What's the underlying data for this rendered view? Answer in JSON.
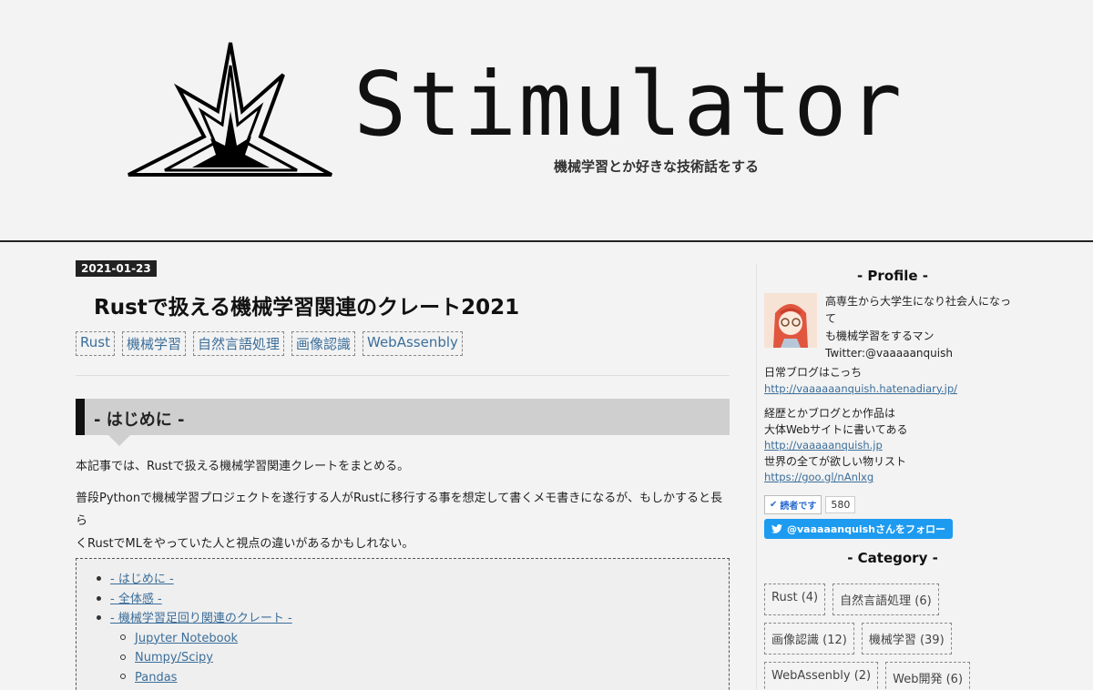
{
  "header": {
    "title": "Stimulator",
    "description": "機械学習とか好きな技術話をする",
    "logo_icon": "starburst-logo-icon"
  },
  "entry": {
    "date": "2021-01-23",
    "title": "Rustで扱える機械学習関連のクレート2021",
    "tags": [
      "Rust",
      "機械学習",
      "自然言語処理",
      "画像認識",
      "WebAssenbly"
    ],
    "section_heading": "- はじめに -",
    "paragraph1": "本記事では、Rustで扱える機械学習関連クレートをまとめる。",
    "paragraph2_line1": "普段Pythonで機械学習プロジェクトを遂行する人がRustに移行する事を想定して書くメモ書きになるが、もしかすると長ら",
    "paragraph2_line2": "くRustでMLをやっていた人と視点の違いがあるかもしれない。",
    "toc": {
      "items": [
        "- はじめに -",
        "- 全体感 -",
        "- 機械学習足回り関連のクレート -"
      ],
      "subitems": [
        "Jupyter Notebook",
        "Numpy/Scipy",
        "Pandas"
      ]
    }
  },
  "sidebar": {
    "profile_heading": "- Profile -",
    "profile_line1": "高専生から大学生になり社会人になって",
    "profile_line2": "も機械学習をするマン",
    "profile_line3": "Twitter:@vaaaaanquish",
    "daily_blog_label": "日常ブログはこっち",
    "daily_blog_link": "http://vaaaaaanquish.hatenadiary.jp/",
    "career_line1": "経歴とかブログとか作品は",
    "career_line2": "大体Webサイトに書いてある",
    "career_link": "http://vaaaaanquish.jp",
    "wishlist_label": "世界の全てが欲しい物リスト",
    "wishlist_link": "https://goo.gl/nAnlxg",
    "reader_label": "読者です",
    "reader_count": "580",
    "follow_label": "@vaaaaanquishさんをフォロー",
    "category_heading": "- Category -",
    "categories": [
      "Rust (4)",
      "自然言語処理 (6)",
      "画像認識 (12)",
      "機械学習 (39)",
      "WebAssenbly (2)",
      "Web開発 (6)"
    ]
  },
  "colors": {
    "link": "#3b6e9a",
    "twitter": "#1d9bf0",
    "header_border": "#222222"
  }
}
